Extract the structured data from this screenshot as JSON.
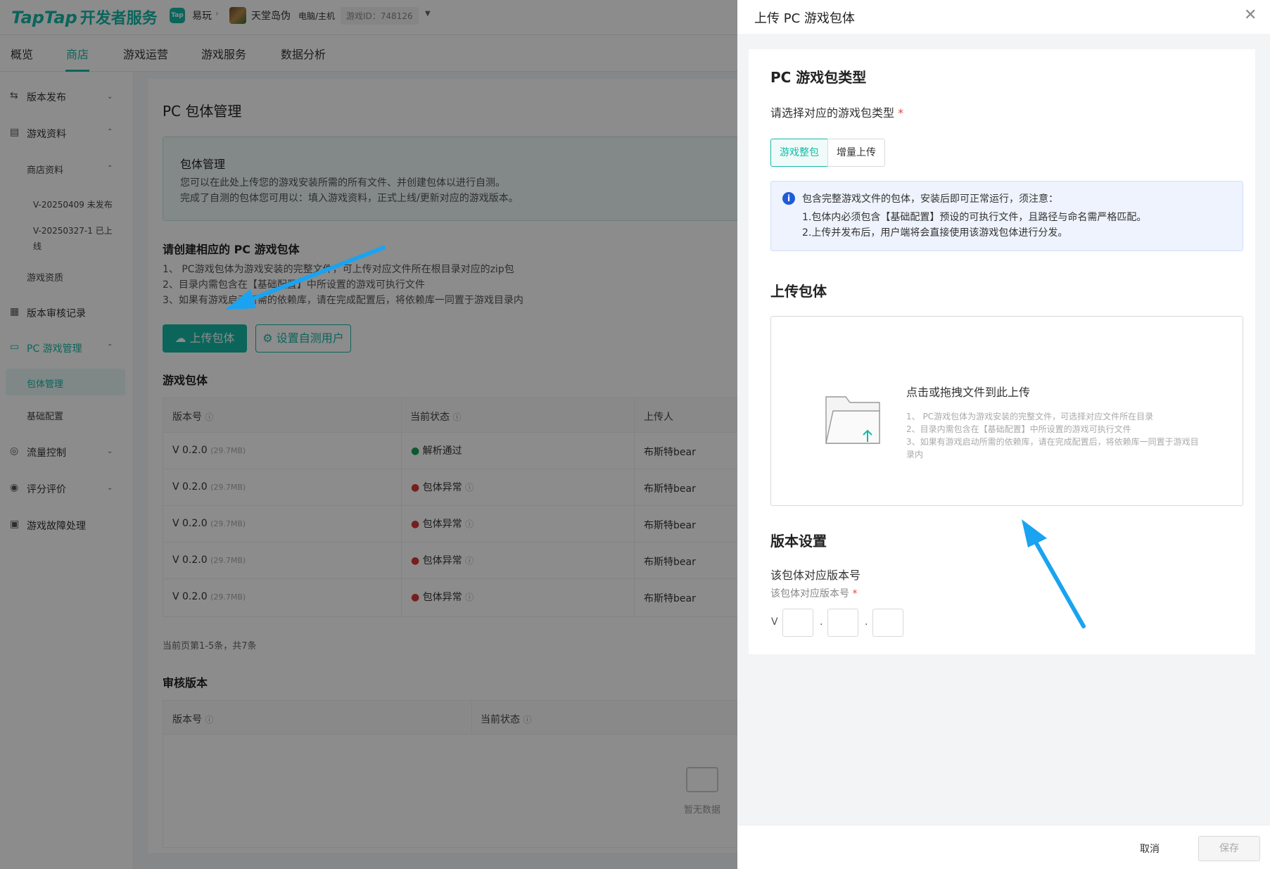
{
  "header": {
    "logo_brand": "TapTap",
    "logo_cn": "开发者服务",
    "app_badge": "Tap",
    "app_name": "易玩",
    "game_name": "天堂岛伪",
    "platform": "电脑/主机",
    "game_id": "游戏ID：748126"
  },
  "nav": {
    "items": [
      "概览",
      "商店",
      "游戏运营",
      "游戏服务",
      "数据分析"
    ],
    "active": "商店"
  },
  "sidebar": {
    "release": "版本发布",
    "game_info": "游戏资料",
    "store_info": "商店资料",
    "v1": "V-20250409 未发布",
    "v2a": "V-20250327-1 已上",
    "v2b": "线",
    "quality": "游戏资质",
    "audit": "版本审核记录",
    "pc_mgmt": "PC 游戏管理",
    "pkg_mgmt": "包体管理",
    "base_cfg": "基础配置",
    "traffic": "流量控制",
    "reviews": "评分评价",
    "fault": "游戏故障处理"
  },
  "main": {
    "page_title": "PC 包体管理",
    "info_title": "包体管理",
    "info_l1": "您可以在此处上传您的游戏安装所需的所有文件、并创建包体以进行自测。",
    "info_l2": "完成了自测的包体您可用以：填入游戏资料，正式上线/更新对应的游戏版本。",
    "create_title": "请创建相应的 PC 游戏包体",
    "rule1": "1、 PC游戏包体为游戏安装的完整文件，可上传对应文件所在根目录对应的zip包",
    "rule2": "2、目录内需包含在【基础配置】中所设置的游戏可执行文件",
    "rule3": "3、如果有游戏启动所需的依赖库，请在完成配置后，将依赖库一同置于游戏目录内",
    "btn_upload": "上传包体",
    "btn_testers": "设置自测用户",
    "pkg_title": "游戏包体",
    "col_version": "版本号",
    "col_status": "当前状态",
    "col_uploader": "上传人",
    "rows": [
      {
        "ver": "V 0.2.0",
        "size": "(29.7MB)",
        "status": "解析通过",
        "uploader": "布斯特bear"
      },
      {
        "ver": "V 0.2.0",
        "size": "(29.7MB)",
        "status": "包体异常",
        "uploader": "布斯特bear"
      },
      {
        "ver": "V 0.2.0",
        "size": "(29.7MB)",
        "status": "包体异常",
        "uploader": "布斯特bear"
      },
      {
        "ver": "V 0.2.0",
        "size": "(29.7MB)",
        "status": "包体异常",
        "uploader": "布斯特bear"
      },
      {
        "ver": "V 0.2.0",
        "size": "(29.7MB)",
        "status": "包体异常",
        "uploader": "布斯特bear"
      }
    ],
    "pager": "当前页第1-5条，共7条",
    "review_title": "审核版本",
    "r_col_version": "版本号",
    "r_col_status": "当前状态",
    "empty": "暂无数据"
  },
  "drawer": {
    "title": "上传 PC 游戏包体",
    "type_title": "PC 游戏包类型",
    "type_label": "请选择对应的游戏包类型",
    "opt_full": "游戏整包",
    "opt_incr": "增量上传",
    "alert_l1": "包含完整游戏文件的包体，安装后即可正常运行，须注意：",
    "alert_l2": "1.包体内必须包含【基础配置】预设的可执行文件，且路径与命名需严格匹配。",
    "alert_l3": "2.上传并发布后，用户端将会直接使用该游戏包体进行分发。",
    "upload_title": "上传包体",
    "drop_title": "点击或拖拽文件到此上传",
    "drop_l1": "1、 PC游戏包体为游戏安装的完整文件，可选择对应文件所在目录",
    "drop_l2": "2、目录内需包含在【基础配置】中所设置的游戏可执行文件",
    "drop_l3": "3、如果有游戏启动所需的依赖库，请在完成配置后，将依赖库一同置于游戏目",
    "drop_l4": "录内",
    "ver_title": "版本设置",
    "ver_label": "该包体对应版本号",
    "ver_sub": "该包体对应版本号",
    "ver_prefix": "V",
    "cancel": "取消",
    "save": "保存"
  },
  "colors": {
    "accent": "#14b9a6",
    "error": "#d93838",
    "success": "#1a9e5c",
    "annotation_arrow": "#1aa3f0",
    "info": "#1f5bd6"
  }
}
